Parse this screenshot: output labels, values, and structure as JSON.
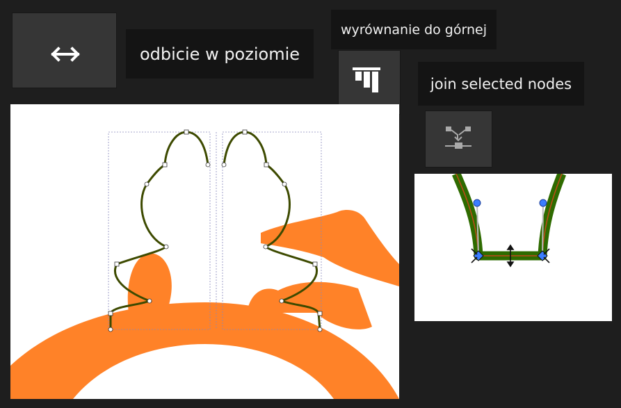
{
  "tooltips": {
    "flip_horizontal": "odbicie w poziomie",
    "align_top": "wyrównanie do górnej",
    "join_nodes": "join selected nodes"
  },
  "icons": {
    "flip_horizontal": "double-arrow-horizontal-icon",
    "align_top": "align-top-edges-icon",
    "join_nodes": "join-nodes-icon"
  },
  "colors": {
    "background": "#1e1e1e",
    "button": "#363636",
    "tooltip_bg": "#141414",
    "tooltip_text": "#f2f2f2",
    "orange_shape": "#ff8228",
    "path_stroke": "#3d4a00",
    "path_stroke_thick": "#2e6b00",
    "node_handle": "#3a7dff"
  }
}
